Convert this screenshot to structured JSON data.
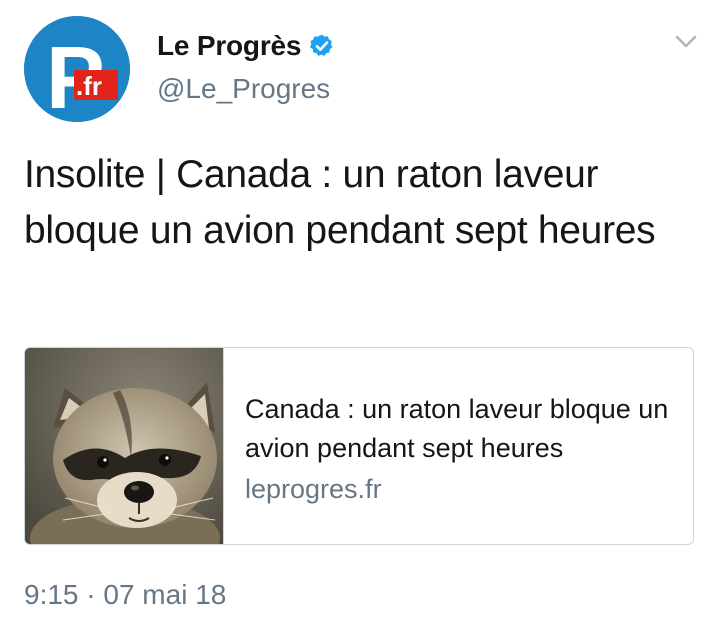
{
  "account": {
    "display_name": "Le Progrès",
    "handle": "@Le_Progres",
    "avatar_text_big": "P",
    "avatar_text_small": ".fr",
    "verified_icon": "verified-badge-icon"
  },
  "menu": {
    "caret_icon": "chevron-down-icon"
  },
  "tweet": {
    "text": "Insolite | Canada : un raton laveur bloque un avion pendant sept heures",
    "timestamp": "9:15 · 07 mai 18"
  },
  "card": {
    "image_icon": "raccoon-photo",
    "title": "Canada : un raton laveur bloque un avion pendant sept heures",
    "domain": "leprogres.fr"
  },
  "colors": {
    "brand_blue": "#1d84c6",
    "logo_red": "#e2231a",
    "verified_blue": "#1da1f2",
    "secondary_text": "#657786",
    "border": "#ccd6dd"
  }
}
